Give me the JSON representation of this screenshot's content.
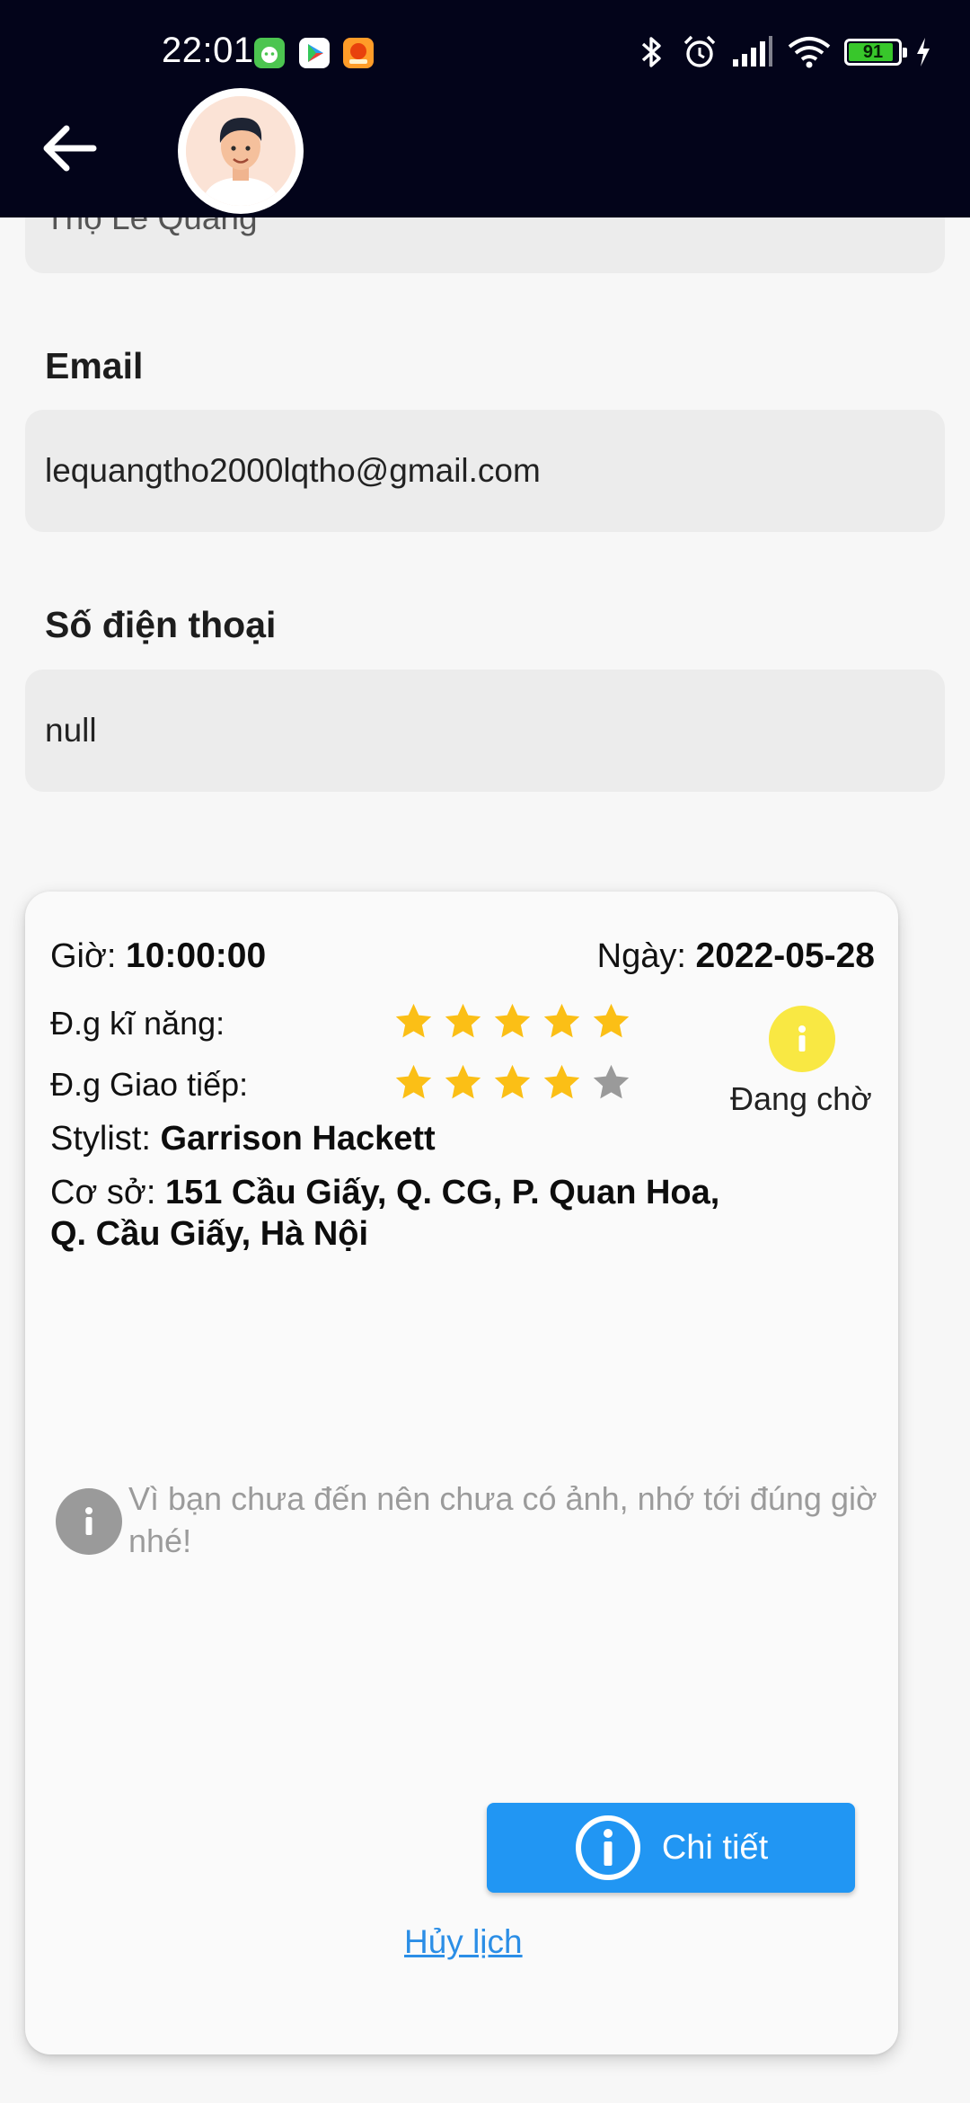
{
  "status_bar": {
    "time": "22:01",
    "battery_level": "91"
  },
  "profile": {
    "name_partial": "Thọ Lê Quang",
    "email_label": "Email",
    "email_value": "lequangtho2000lqtho@gmail.com",
    "phone_label": "Số điện thoại",
    "phone_value": "null"
  },
  "appointment": {
    "time_label": "Giờ:",
    "time_value": "10:00:00",
    "date_label": "Ngày:",
    "date_value": "2022-05-28",
    "skill_label": "Đ.g kĩ năng:",
    "skill_rating": 5,
    "communication_label": "Đ.g Giao tiếp:",
    "communication_rating": 4,
    "rating_max": 5,
    "stylist_label": "Stylist:",
    "stylist_value": "Garrison Hackett",
    "branch_label": "Cơ sở:",
    "branch_value_line1": "151 Cầu Giấy, Q. CG, P. Quan Hoa,",
    "branch_value_line2": "Q. Cầu Giấy, Hà Nội",
    "status_text": "Đang chờ",
    "status_color": "#f9e843",
    "note_text": "Vì bạn chưa đến nên chưa có ảnh, nhớ tới đúng giờ nhé!",
    "detail_button_label": "Chi tiết",
    "cancel_link_label": "Hủy lịch"
  },
  "colors": {
    "appbar": "#03041a",
    "star_filled": "#fbbf16",
    "star_empty": "#9a9a9a",
    "primary": "#2196f3",
    "link": "#2b8ee6"
  }
}
